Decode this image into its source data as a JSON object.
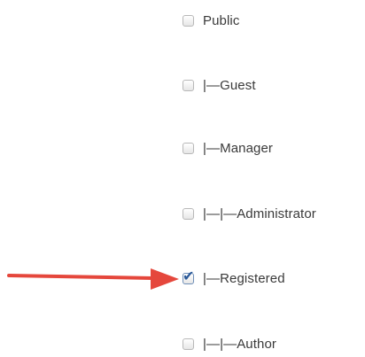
{
  "groups": [
    {
      "label": "Public",
      "checked": false
    },
    {
      "label": "|—Guest",
      "checked": false
    },
    {
      "label": "|—Manager",
      "checked": false
    },
    {
      "label": "|—|—Administrator",
      "checked": false
    },
    {
      "label": "|—Registered",
      "checked": true
    },
    {
      "label": "|—|—Author",
      "checked": false
    }
  ],
  "colors": {
    "arrow": "#e5473c",
    "checkmark": "#2b5a9a",
    "text": "#3a3a3a"
  },
  "annotation": {
    "icon": "red-arrow-icon",
    "points_to": "|—Registered"
  }
}
